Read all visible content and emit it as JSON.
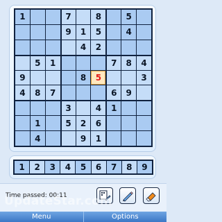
{
  "board": {
    "rows": [
      [
        "1",
        "",
        "",
        "7",
        "",
        "8",
        "",
        "5",
        ""
      ],
      [
        "",
        "",
        "",
        "9",
        "1",
        "5",
        "",
        "4",
        ""
      ],
      [
        "",
        "",
        "",
        "",
        "4",
        "2",
        "",
        "",
        ""
      ],
      [
        "",
        "5",
        "1",
        "",
        "",
        "",
        "7",
        "8",
        "4"
      ],
      [
        "9",
        "",
        "",
        "",
        "8",
        "5",
        "",
        "",
        "3"
      ],
      [
        "4",
        "8",
        "7",
        "",
        "",
        "",
        "6",
        "9",
        ""
      ],
      [
        "",
        "",
        "",
        "3",
        "",
        "4",
        "1",
        "",
        ""
      ],
      [
        "",
        "1",
        "",
        "5",
        "2",
        "6",
        "",
        "",
        ""
      ],
      [
        "",
        "4",
        "",
        "",
        "9",
        "1",
        "",
        "",
        ""
      ]
    ],
    "selected": {
      "row": 4,
      "col": 5
    }
  },
  "number_bar": [
    "1",
    "2",
    "3",
    "4",
    "5",
    "6",
    "7",
    "8",
    "9"
  ],
  "status": {
    "time_label": "Time passed: 00:11"
  },
  "tools": [
    {
      "name": "notes-icon"
    },
    {
      "name": "pencil-icon"
    },
    {
      "name": "eraser-icon"
    }
  ],
  "softkeys": {
    "left": "Menu",
    "right": "Options"
  },
  "watermark": "UpdateStar.com",
  "colors": {
    "cell": "#aacbf2",
    "cell_alt": "#c5ddf8",
    "selected_cell": "#ffe8bf",
    "selected_digit": "#e41b1b",
    "softkey_bar": "#3b77c6"
  }
}
